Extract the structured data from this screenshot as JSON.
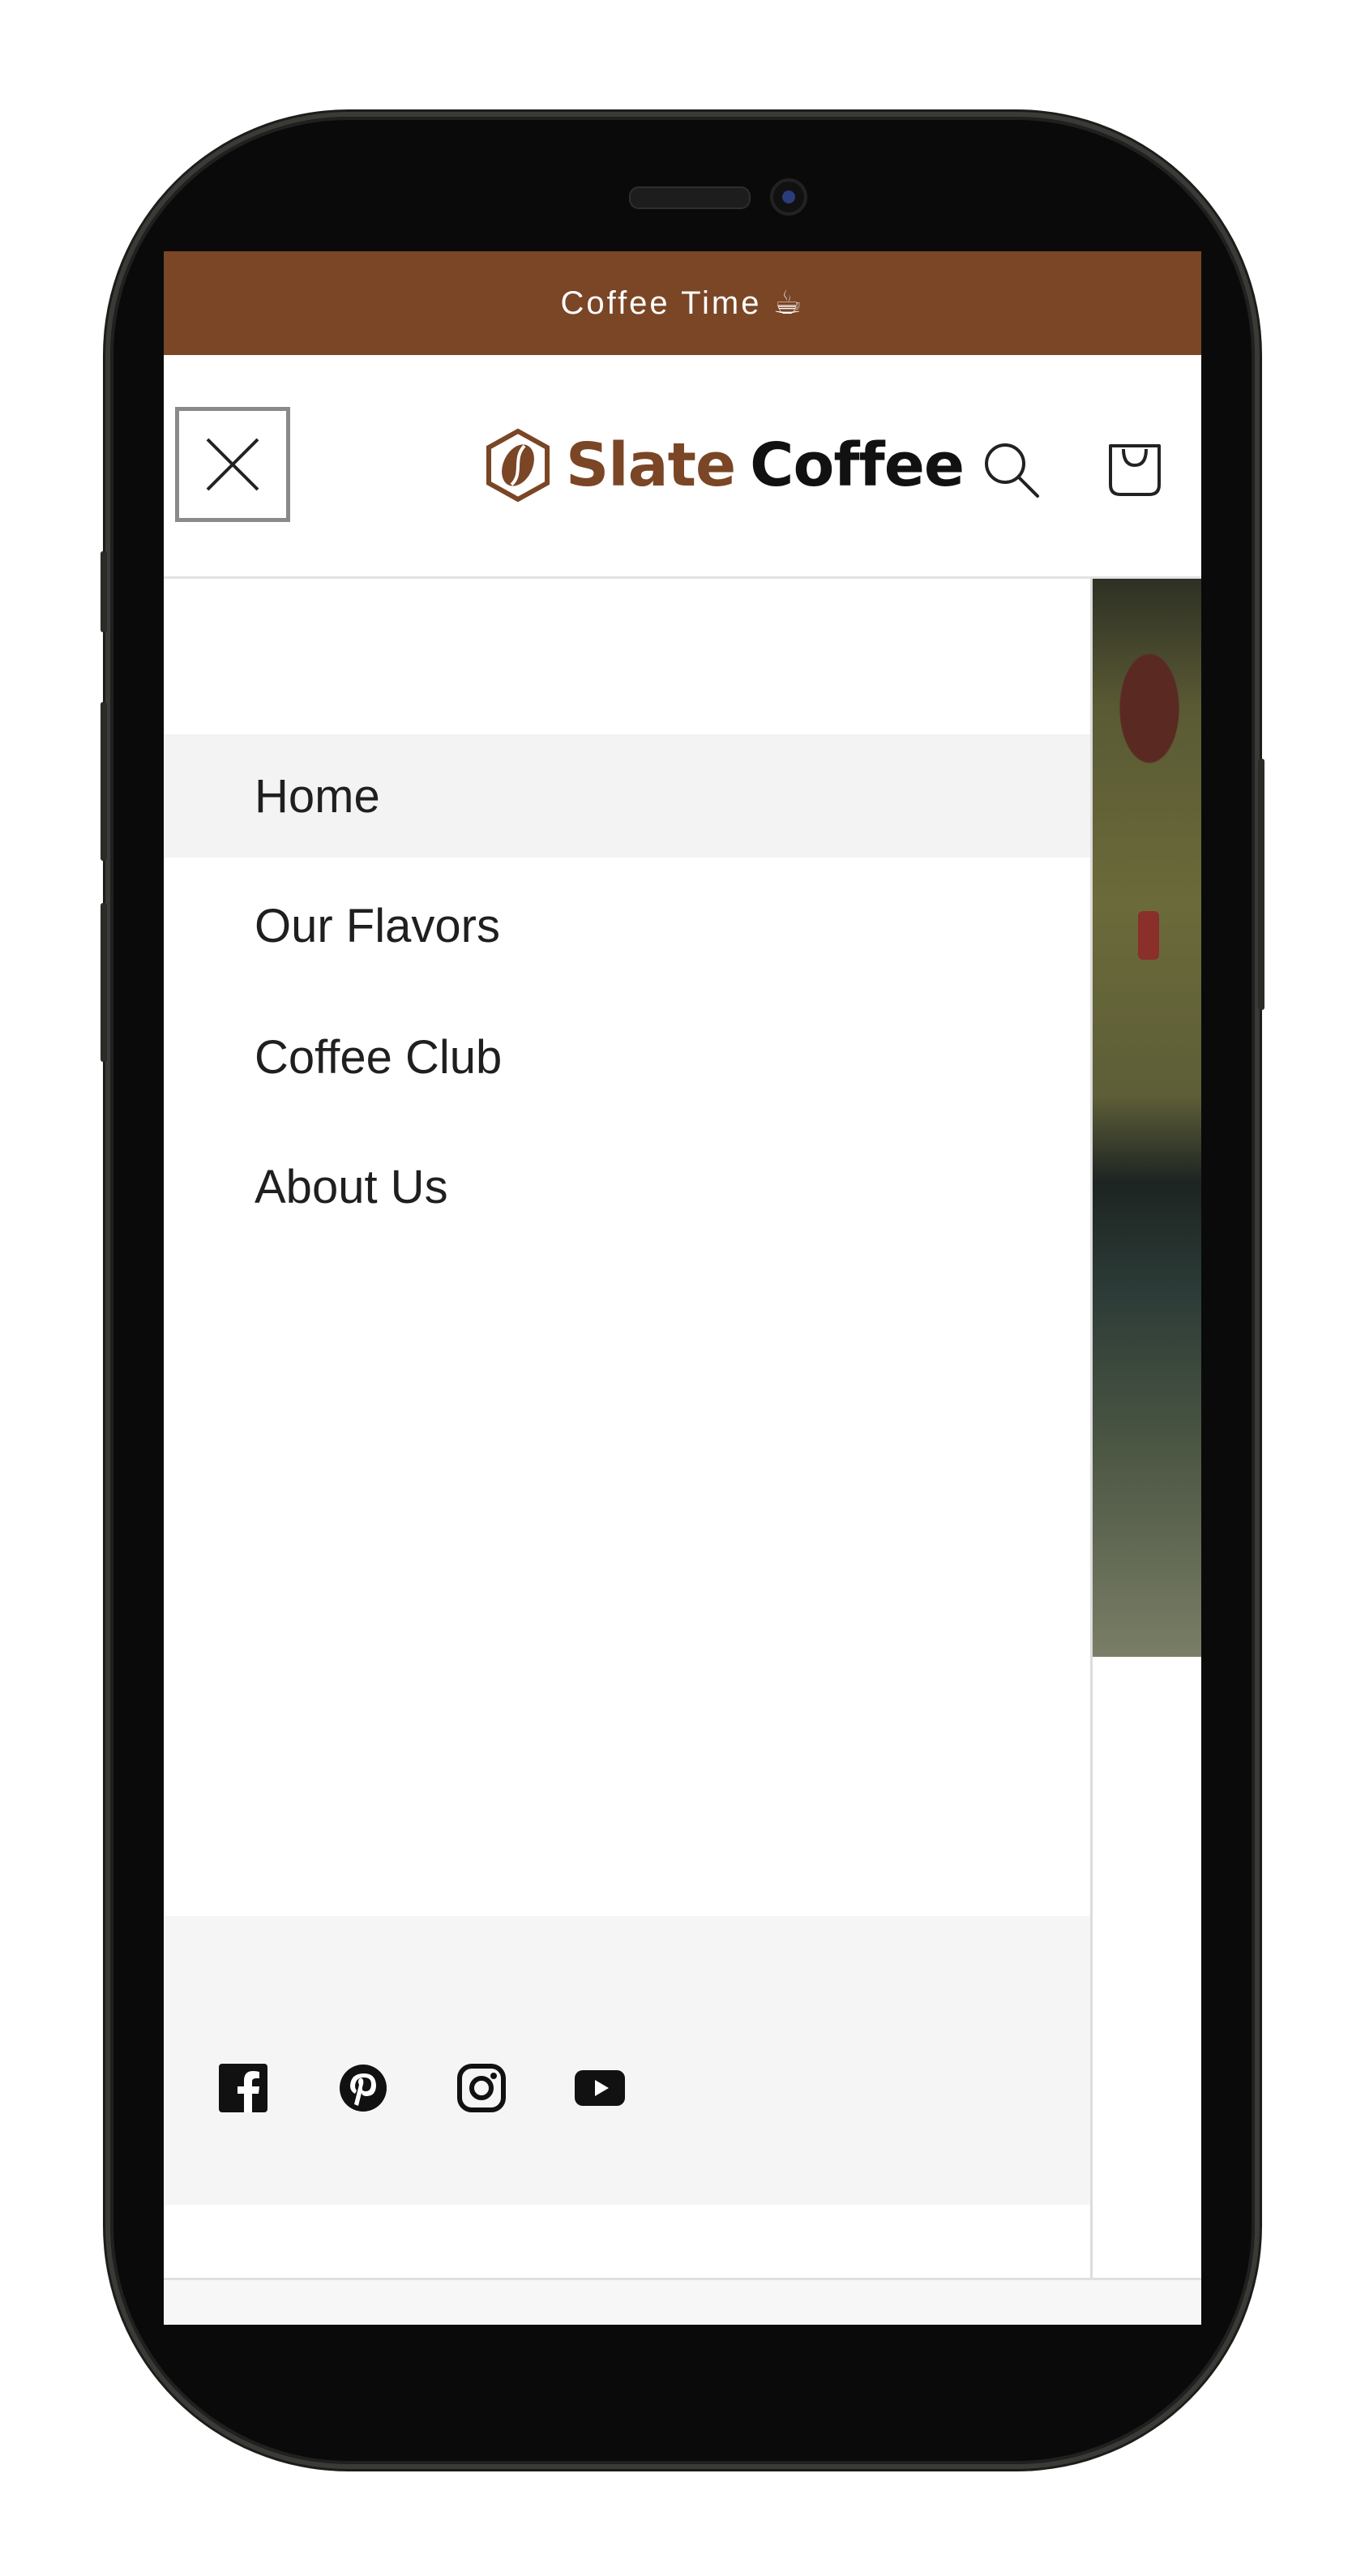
{
  "announcement": {
    "text": "Coffee Time ☕"
  },
  "header": {
    "logo": {
      "part1": "Slate",
      "part2": "Coffee"
    },
    "icons": {
      "close": "close-icon",
      "search": "search-icon",
      "cart": "cart-icon"
    }
  },
  "menu": {
    "items": [
      {
        "label": "Home",
        "active": true
      },
      {
        "label": "Our Flavors",
        "active": false
      },
      {
        "label": "Coffee Club",
        "active": false
      },
      {
        "label": "About Us",
        "active": false
      }
    ]
  },
  "social": {
    "icons": [
      "facebook-icon",
      "pinterest-icon",
      "instagram-icon",
      "youtube-icon"
    ]
  },
  "colors": {
    "brand": "#7a4626",
    "announcement_bg": "#7a4626",
    "active_row_bg": "#f3f3f3",
    "footer_bg": "#f5f5f5"
  }
}
